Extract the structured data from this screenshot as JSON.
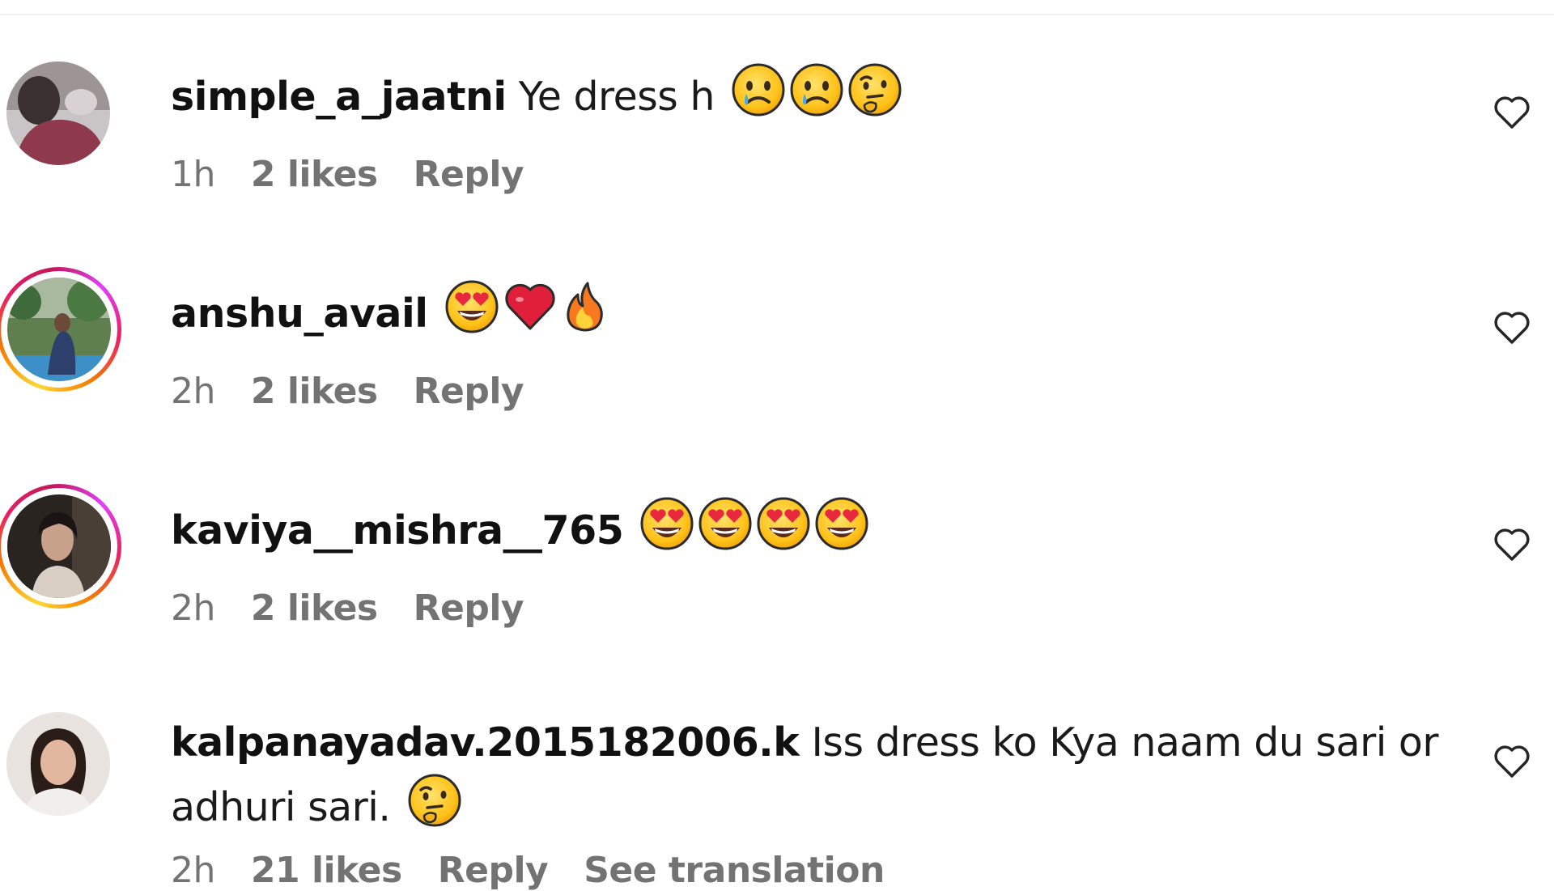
{
  "comments": [
    {
      "username": "simple_a_jaatni",
      "text": "Ye dress h",
      "emojis": [
        "sad-tear-emoji",
        "sad-tear-emoji",
        "thinking-emoji"
      ],
      "time": "1h",
      "likes": "2 likes",
      "reply": "Reply",
      "story_ring": false
    },
    {
      "username": "anshu_avail",
      "text": "",
      "emojis": [
        "heart-eyes-emoji",
        "red-heart-emoji",
        "fire-emoji"
      ],
      "time": "2h",
      "likes": "2 likes",
      "reply": "Reply",
      "story_ring": true
    },
    {
      "username": "kaviya__mishra__765",
      "text": "",
      "emojis": [
        "heart-eyes-emoji",
        "heart-eyes-emoji",
        "heart-eyes-emoji",
        "heart-eyes-emoji"
      ],
      "time": "2h",
      "likes": "2 likes",
      "reply": "Reply",
      "story_ring": true
    },
    {
      "username": "kalpanayadav.2015182006.k",
      "text_line1": "Iss dress ko Kya naam du sari or",
      "text_line2": "adhuri sari.",
      "emojis": [
        "thinking-emoji"
      ],
      "time": "2h",
      "likes": "21 likes",
      "reply": "Reply",
      "translate": "See translation",
      "story_ring": false
    }
  ],
  "colors": {
    "username": "#111111",
    "meta": "#737373",
    "divider": "#efefef",
    "story_ring": [
      "#fdd835",
      "#f57c00",
      "#e91e63",
      "#e040fb"
    ]
  },
  "icons": {
    "like": "heart-outline-icon"
  }
}
